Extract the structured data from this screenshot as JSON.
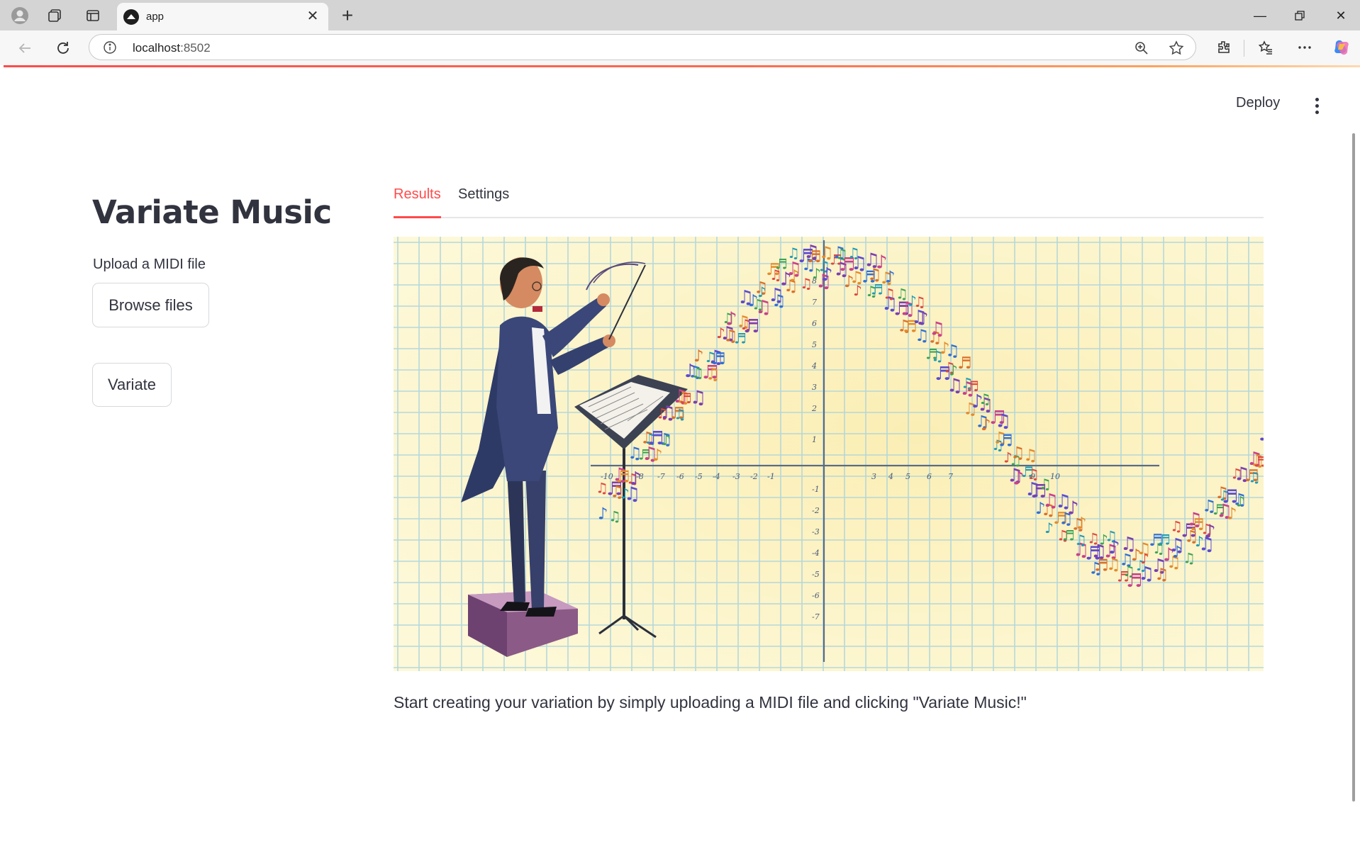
{
  "browser": {
    "tab_title": "app",
    "url_host": "localhost",
    "url_port": ":8502"
  },
  "header": {
    "deploy_label": "Deploy"
  },
  "sidebar": {
    "title": "Variate Music",
    "upload_label": "Upload a MIDI file",
    "browse_button": "Browse files",
    "variate_button": "Variate"
  },
  "tabs": [
    {
      "label": "Results",
      "active": true
    },
    {
      "label": "Settings",
      "active": false
    }
  ],
  "graph_labels": {
    "x_ticks": [
      "-10",
      "-8",
      "-7",
      "-6",
      "-5",
      "-4",
      "-3",
      "-2",
      "-1",
      "3",
      "4",
      "5",
      "6",
      "7",
      "9",
      "10"
    ],
    "y_ticks": [
      "9",
      "8",
      "7",
      "6",
      "5",
      "4",
      "3",
      "2",
      "1",
      "-1",
      "-2",
      "-3",
      "-4",
      "-5",
      "-6",
      "-7"
    ]
  },
  "results": {
    "caption": "Start creating your variation by simply uploading a MIDI file and clicking \"Variate Music!\""
  },
  "colors": {
    "accent": "#ff4b4b",
    "text": "#31333f",
    "paper": "#fbf4c4",
    "grid": "#a9d3dc"
  }
}
